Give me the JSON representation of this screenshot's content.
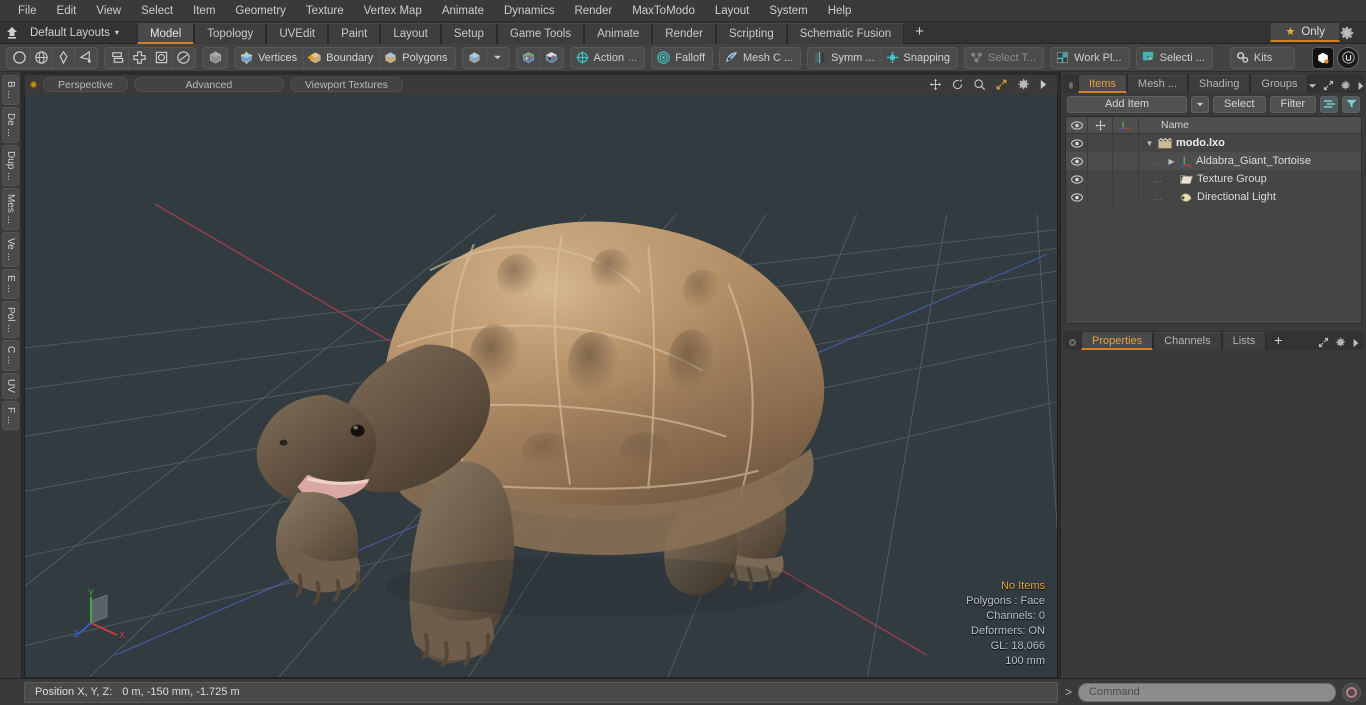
{
  "app": {
    "title": "modo"
  },
  "menubar": {
    "items": [
      {
        "label": "File"
      },
      {
        "label": "Edit"
      },
      {
        "label": "View"
      },
      {
        "label": "Select"
      },
      {
        "label": "Item"
      },
      {
        "label": "Geometry"
      },
      {
        "label": "Texture"
      },
      {
        "label": "Vertex Map"
      },
      {
        "label": "Animate"
      },
      {
        "label": "Dynamics"
      },
      {
        "label": "Render"
      },
      {
        "label": "MaxToModo"
      },
      {
        "label": "Layout"
      },
      {
        "label": "System"
      },
      {
        "label": "Help"
      }
    ]
  },
  "layoutbar": {
    "home_icon": "home-up-icon",
    "layout_name": "Default Layouts",
    "dropdown_glyph": "▾",
    "tabs": [
      {
        "label": "Model",
        "active": true
      },
      {
        "label": "Topology",
        "active": false
      },
      {
        "label": "UVEdit",
        "active": false
      },
      {
        "label": "Paint",
        "active": false
      },
      {
        "label": "Layout",
        "active": false
      },
      {
        "label": "Setup",
        "active": false
      },
      {
        "label": "Game Tools",
        "active": false
      },
      {
        "label": "Animate",
        "active": false
      },
      {
        "label": "Render",
        "active": false
      },
      {
        "label": "Scripting",
        "active": false
      },
      {
        "label": "Schematic Fusion",
        "active": false
      }
    ],
    "add_tab_label": "+",
    "only_button": {
      "label": "Only",
      "icon": "star-icon"
    },
    "settings_icon": "gear-icon"
  },
  "toolbar": {
    "groups": [
      {
        "name": "primitive-group",
        "buttons": [
          {
            "name": "circle-tool",
            "icon": "circle-icon",
            "label": ""
          },
          {
            "name": "sphere-tool",
            "icon": "globe-icon",
            "label": ""
          },
          {
            "name": "pen-tool",
            "icon": "pen-icon",
            "label": ""
          },
          {
            "name": "curve-tool",
            "icon": "curve-icon",
            "label": ""
          }
        ]
      },
      {
        "name": "arrange-group",
        "buttons": [
          {
            "name": "align-tool",
            "icon": "stack-icon",
            "label": ""
          },
          {
            "name": "center-tool",
            "icon": "cross-box-icon",
            "label": ""
          },
          {
            "name": "bound-tool",
            "icon": "square-circle-icon",
            "label": ""
          },
          {
            "name": "radial-tool",
            "icon": "circle-slash-icon",
            "label": ""
          }
        ]
      },
      {
        "name": "item-mode-group",
        "buttons": [
          {
            "name": "item-mode",
            "icon": "cube-gray-icon",
            "label": ""
          }
        ]
      },
      {
        "name": "selection-mode-group",
        "buttons": [
          {
            "name": "vertices-mode",
            "icon": "cube-blue-icon",
            "label": "Vertices"
          },
          {
            "name": "boundary-mode",
            "icon": "cube-arrow-icon",
            "label": "Boundary"
          },
          {
            "name": "polygons-mode",
            "icon": "cube-tan-icon",
            "label": "Polygons"
          }
        ]
      },
      {
        "name": "component-group",
        "buttons": [
          {
            "name": "component-cube",
            "icon": "cube-blue-small-icon",
            "label": ""
          },
          {
            "name": "component-dropdown",
            "icon": "chevron-down-icon",
            "label": ""
          }
        ]
      },
      {
        "name": "axis-group",
        "buttons": [
          {
            "name": "axis-cube-1",
            "icon": "axis-cube-icon",
            "label": ""
          },
          {
            "name": "axis-cube-2",
            "icon": "axis-cube-alt-icon",
            "label": ""
          }
        ]
      }
    ],
    "solo_buttons": [
      {
        "name": "action-center",
        "icon": "target-icon",
        "label": "Action",
        "suffix": "...",
        "dim": false
      },
      {
        "name": "falloff",
        "icon": "falloff-icon",
        "label": "Falloff",
        "suffix": "",
        "dim": false
      },
      {
        "name": "mesh-constraint",
        "icon": "mesh-constraint-icon",
        "label": "Mesh C ...",
        "suffix": "",
        "dim": false
      },
      {
        "name": "symmetry",
        "icon": "symmetry-icon",
        "label": "Symm ...",
        "suffix": "",
        "dim": false
      },
      {
        "name": "snapping",
        "icon": "snapping-icon",
        "label": "Snapping",
        "suffix": "",
        "dim": false
      },
      {
        "name": "select-through",
        "icon": "select-through-icon",
        "label": "Select T...",
        "suffix": "",
        "dim": true
      },
      {
        "name": "work-plane",
        "icon": "work-plane-icon",
        "label": "Work Pl...",
        "suffix": "",
        "dim": false
      },
      {
        "name": "selection-sets",
        "icon": "selection-icon",
        "label": "Selecti ...",
        "suffix": "",
        "dim": false
      },
      {
        "name": "kits",
        "icon": "kits-gear-icon",
        "label": "Kits",
        "suffix": "",
        "dim": false
      }
    ],
    "right_icons": [
      {
        "name": "modo-logo-icon"
      },
      {
        "name": "unreal-logo-icon"
      }
    ]
  },
  "vtabs": {
    "items": [
      {
        "label": "B ..."
      },
      {
        "label": "De ..."
      },
      {
        "label": "Dup ..."
      },
      {
        "label": "Mes ..."
      },
      {
        "label": "Ve ..."
      },
      {
        "label": "E ..."
      },
      {
        "label": "Pol ..."
      },
      {
        "label": "C ..."
      },
      {
        "label": "UV"
      },
      {
        "label": "F ..."
      }
    ]
  },
  "viewport": {
    "header": {
      "pills": [
        {
          "label": "Perspective",
          "name": "viewport-view-mode"
        },
        {
          "label": "Advanced",
          "name": "viewport-shading-mode"
        },
        {
          "label": "Viewport Textures",
          "name": "viewport-texture-mode"
        }
      ],
      "right_icons": [
        {
          "name": "pan-icon"
        },
        {
          "name": "rotate-icon"
        },
        {
          "name": "zoom-icon"
        },
        {
          "name": "maximize-icon"
        },
        {
          "name": "gear-icon"
        },
        {
          "name": "arrow-right-icon"
        }
      ]
    },
    "scene": {
      "model_name": "Aldabra Giant Tortoise",
      "background_color": "#323b40",
      "grid_color": "#9aa5ab",
      "x_axis_color": "#b2404a",
      "z_axis_color": "#4a5fb2"
    },
    "gizmo": {
      "x_label": "X",
      "y_label": "Y",
      "z_label": "Z"
    },
    "info": {
      "items": "No Items",
      "polygons": "Polygons : Face",
      "channels": "Channels: 0",
      "deformers": "Deformers: ON",
      "gl": "GL: 18,066",
      "scale": "100 mm"
    }
  },
  "right_panel": {
    "tabs": [
      {
        "label": "Items",
        "active": true
      },
      {
        "label": "Mesh ...",
        "active": false
      },
      {
        "label": "Shading",
        "active": false
      },
      {
        "label": "Groups",
        "active": false
      }
    ],
    "tab_right_icons": [
      {
        "name": "chevron-down-icon"
      },
      {
        "name": "expand-icon"
      },
      {
        "name": "gear-icon"
      },
      {
        "name": "arrow-right-icon"
      }
    ],
    "item_bar": {
      "add_item_label": "Add Item",
      "add_item_dropdown": "▾",
      "select_label": "Select",
      "filter_label": "Filter",
      "list_icon": "list-icon",
      "funnel_icon": "funnel-icon"
    },
    "list": {
      "columns": [
        {
          "name": "visibility-column",
          "icon": "eye-icon"
        },
        {
          "name": "lock-column",
          "icon": "move-icon"
        },
        {
          "name": "axis-column",
          "icon": "axis-icon"
        },
        {
          "name": "name-column",
          "label": "Name"
        }
      ],
      "rows": [
        {
          "name": "modo.lxo",
          "icon": "scene-icon",
          "depth": 0,
          "bold": true,
          "expander": "▼"
        },
        {
          "name": "Aldabra_Giant_Tortoise",
          "icon": "mesh-icon",
          "depth": 1,
          "bold": false,
          "expander": "▶"
        },
        {
          "name": "Texture Group",
          "icon": "folder-icon",
          "depth": 1,
          "bold": false,
          "expander": ""
        },
        {
          "name": "Directional Light",
          "icon": "light-icon",
          "depth": 1,
          "bold": false,
          "expander": ""
        }
      ]
    },
    "bottom_tabs": [
      {
        "label": "Properties",
        "active": true
      },
      {
        "label": "Channels",
        "active": false
      },
      {
        "label": "Lists",
        "active": false
      },
      {
        "label": "+",
        "active": false
      }
    ],
    "bottom_tab_right_icons": [
      {
        "name": "expand-icon"
      },
      {
        "name": "gear-icon"
      },
      {
        "name": "arrow-right-icon"
      }
    ]
  },
  "statusbar": {
    "position_label": "Position X, Y, Z:",
    "position_value": "0 m, -150 mm, -1.725 m",
    "command_prompt": ">",
    "command_placeholder": "Command",
    "record_icon": "record-icon"
  },
  "colors": {
    "accent": "#d08020",
    "highlight_text": "#e3a23b",
    "panel_bg": "#3a3a3a",
    "toolbar_bg": "#434343",
    "viewport_bg": "#323b40"
  }
}
